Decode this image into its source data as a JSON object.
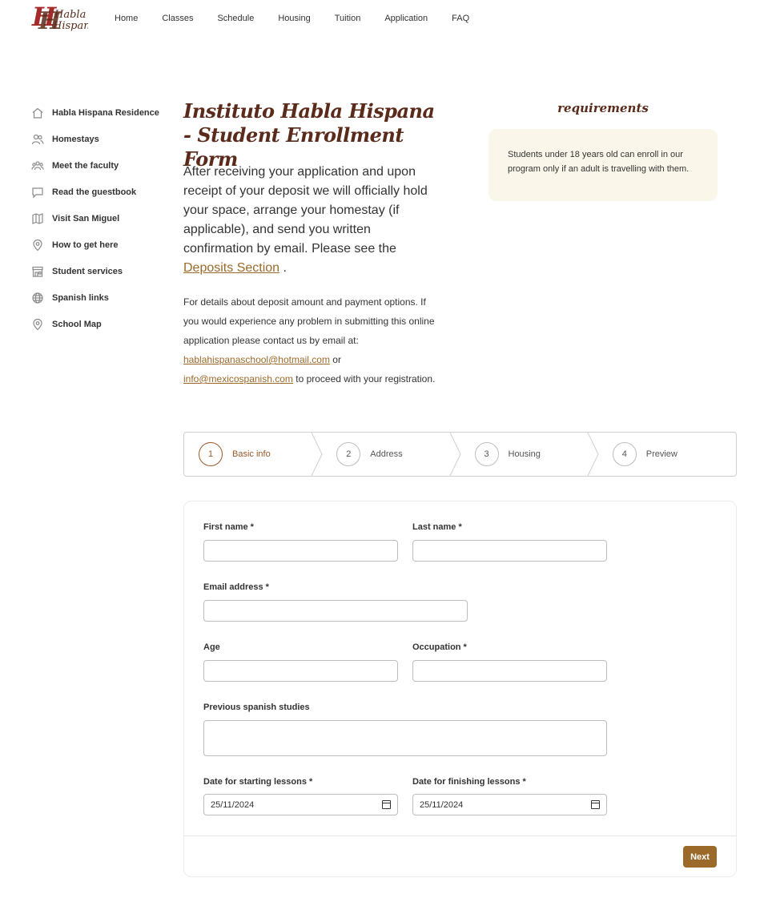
{
  "logo": {
    "text_line1": "Habla",
    "text_line2": "Hispana"
  },
  "nav": [
    "Home",
    "Classes",
    "Schedule",
    "Housing",
    "Tuition",
    "Application",
    "FAQ"
  ],
  "sidebar": {
    "items": [
      {
        "label": "Habla Hispana Residence",
        "icon": "home-icon"
      },
      {
        "label": "Homestays",
        "icon": "users-icon"
      },
      {
        "label": "Meet the faculty",
        "icon": "group-icon"
      },
      {
        "label": "Read the guestbook",
        "icon": "chat-icon"
      },
      {
        "label": "Visit San Miguel",
        "icon": "map-icon"
      },
      {
        "label": "How to get here",
        "icon": "pin-icon"
      },
      {
        "label": "Student services",
        "icon": "store-icon"
      },
      {
        "label": "Spanish links",
        "icon": "globe-icon"
      },
      {
        "label": "School Map",
        "icon": "pin-icon"
      }
    ]
  },
  "page": {
    "title": "Instituto Habla Hispana - Student Enrollment Form",
    "intro_text": "After receiving your application and upon receipt of your deposit we will officially hold your space, arrange your homestay (if applicable), and send you written confirmation by email. Please see the",
    "intro_link": "Deposits Section",
    "intro_end": ".",
    "details_text": "For details about deposit amount and payment options. If you would experience any problem in submitting this online application please contact us by email at:",
    "email1": "hablahispanaschool@hotmail.com",
    "or_text": "or",
    "email2": "info@mexicospanish.com",
    "details_end": "to proceed with your registration."
  },
  "requirements": {
    "title": "requirements",
    "text": "Students under 18 years old can enroll in our program only if an adult is travelling with them."
  },
  "stepper": {
    "steps": [
      {
        "num": "1",
        "label": "Basic info",
        "active": true
      },
      {
        "num": "2",
        "label": "Address",
        "active": false
      },
      {
        "num": "3",
        "label": "Housing",
        "active": false
      },
      {
        "num": "4",
        "label": "Preview",
        "active": false
      }
    ]
  },
  "form": {
    "first_name": {
      "label": "First name *",
      "value": ""
    },
    "last_name": {
      "label": "Last name *",
      "value": ""
    },
    "email": {
      "label": "Email address *",
      "value": ""
    },
    "age": {
      "label": "Age",
      "value": ""
    },
    "occupation": {
      "label": "Occupation *",
      "value": ""
    },
    "previous_studies": {
      "label": "Previous spanish studies",
      "value": ""
    },
    "start_date": {
      "label": "Date for starting lessons *",
      "value": "25/11/2024"
    },
    "end_date": {
      "label": "Date for finishing lessons *",
      "value": "25/11/2024"
    },
    "next_label": "Next"
  },
  "colors": {
    "accent": "#9b6a2b",
    "title": "#5a2a1a",
    "req_bg": "#faf7ea"
  }
}
